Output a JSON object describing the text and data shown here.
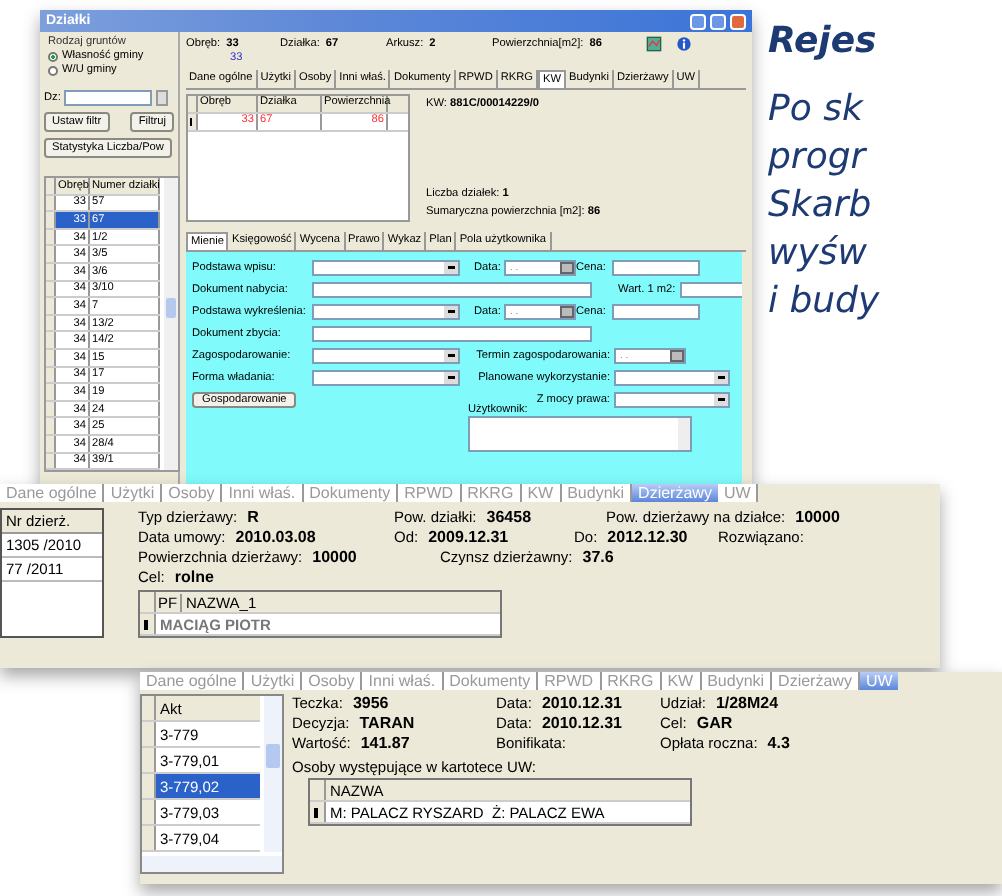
{
  "main_window": {
    "title": "Działki",
    "filter": {
      "title": "Rodzaj gruntów",
      "options": [
        {
          "label": "Własność gminy",
          "selected": true
        },
        {
          "label": "W/U gminy",
          "selected": false
        }
      ],
      "dz_label": "Dz:",
      "buttons": [
        "Ustaw filtr",
        "Filtruj",
        "Statystyka Liczba/Pow"
      ]
    },
    "parcel_table": {
      "columns": [
        "Obręb",
        "Numer działki"
      ],
      "rows": [
        {
          "cells": [
            "33",
            "57"
          ],
          "selected": false
        },
        {
          "cells": [
            "33",
            "67"
          ],
          "selected": true
        },
        {
          "cells": [
            "34",
            "1/2"
          ],
          "selected": false
        },
        {
          "cells": [
            "34",
            "3/5"
          ],
          "selected": false
        },
        {
          "cells": [
            "34",
            "3/6"
          ],
          "selected": false
        },
        {
          "cells": [
            "34",
            "3/10"
          ],
          "selected": false
        },
        {
          "cells": [
            "34",
            "7"
          ],
          "selected": false
        },
        {
          "cells": [
            "34",
            "13/2"
          ],
          "selected": false
        },
        {
          "cells": [
            "34",
            "14/2"
          ],
          "selected": false
        },
        {
          "cells": [
            "34",
            "15"
          ],
          "selected": false
        },
        {
          "cells": [
            "34",
            "17"
          ],
          "selected": false
        },
        {
          "cells": [
            "34",
            "19"
          ],
          "selected": false
        },
        {
          "cells": [
            "34",
            "24"
          ],
          "selected": false
        },
        {
          "cells": [
            "34",
            "25"
          ],
          "selected": false
        },
        {
          "cells": [
            "34",
            "28/4"
          ],
          "selected": false
        },
        {
          "cells": [
            "34",
            "39/1"
          ],
          "selected": false
        }
      ]
    },
    "header": {
      "fields": [
        {
          "label": "Obręb:",
          "value": "33"
        },
        {
          "label": "Działka:",
          "value": "67"
        },
        {
          "label": "Arkusz:",
          "value": "2"
        },
        {
          "label": "Powierzchnia[m2]:",
          "value": "86"
        }
      ],
      "sub_value": "33"
    },
    "tabs": [
      {
        "label": "Dane ogólne",
        "selected": false
      },
      {
        "label": "Użytki",
        "selected": false
      },
      {
        "label": "Osoby",
        "selected": false
      },
      {
        "label": "Inni właś.",
        "selected": false
      },
      {
        "label": "Dokumenty",
        "selected": false
      },
      {
        "label": "RPWD",
        "selected": false
      },
      {
        "label": "RKRG",
        "selected": false
      },
      {
        "label": "KW",
        "selected": true
      },
      {
        "label": "Budynki",
        "selected": false
      },
      {
        "label": "Dzierżawy",
        "selected": false
      },
      {
        "label": "UW",
        "selected": false
      }
    ],
    "kw_table": {
      "columns": [
        "Obręb",
        "Działka",
        "Powierzchnia"
      ],
      "rows": [
        [
          "33",
          "67",
          "86"
        ]
      ]
    },
    "kw": {
      "label": "KW:",
      "value": "881C/00014229/0"
    },
    "summary": [
      {
        "label": "Liczba działek:",
        "value": "1"
      },
      {
        "label": "Sumaryczna powierzchnia [m2]:",
        "value": "86"
      }
    ],
    "lower_tabs": [
      {
        "label": "Mienie",
        "selected": true
      },
      {
        "label": "Księgowość",
        "selected": false
      },
      {
        "label": "Wycena",
        "selected": false
      },
      {
        "label": "Prawo",
        "selected": false
      },
      {
        "label": "Wykaz",
        "selected": false
      },
      {
        "label": "Plan",
        "selected": false
      },
      {
        "label": "Pola użytkownika",
        "selected": false
      }
    ],
    "form": [
      [
        {
          "kind": "select",
          "label": "Podstawa wpisu:"
        },
        {
          "kind": "date",
          "label": "Data:",
          "placeholder": ". ."
        },
        {
          "kind": "text",
          "label": "Cena:"
        }
      ],
      [
        {
          "kind": "text",
          "label": "Dokument nabycia:"
        },
        {
          "kind": "text",
          "label": "Wart. 1 m2:"
        }
      ],
      [
        {
          "kind": "select",
          "label": "Podstawa wykreślenia:"
        },
        {
          "kind": "date",
          "label": "Data:",
          "placeholder": ". ."
        },
        {
          "kind": "text",
          "label": "Cena:"
        }
      ],
      [
        {
          "kind": "text",
          "label": "Dokument zbycia:"
        }
      ],
      [
        {
          "kind": "select",
          "label": "Zagospodarowanie:"
        },
        {
          "kind": "date",
          "label": "Termin zagospodarowania:",
          "placeholder": ". ."
        }
      ],
      [
        {
          "kind": "select",
          "label": "Forma władania:"
        },
        {
          "kind": "select",
          "label": "Planowane wykorzystanie:"
        }
      ],
      [
        {
          "kind": "button",
          "label": "Gospodarowanie"
        },
        {
          "kind": "select",
          "label": "Z mocy prawa:"
        }
      ],
      [
        {
          "kind": "textarea",
          "label": "Użytkownik:"
        }
      ]
    ]
  },
  "lease_window": {
    "tabs": [
      {
        "label": "Dane ogólne",
        "selected": false
      },
      {
        "label": "Użytki",
        "selected": false
      },
      {
        "label": "Osoby",
        "selected": false
      },
      {
        "label": "Inni właś.",
        "selected": false
      },
      {
        "label": "Dokumenty",
        "selected": false
      },
      {
        "label": "RPWD",
        "selected": false
      },
      {
        "label": "RKRG",
        "selected": false
      },
      {
        "label": "KW",
        "selected": false
      },
      {
        "label": "Budynki",
        "selected": false
      },
      {
        "label": "Dzierżawy",
        "selected": true
      },
      {
        "label": "UW",
        "selected": false
      }
    ],
    "lease_table": {
      "columns": [
        "Nr dzierż."
      ],
      "rows": [
        "1305 /2010",
        "77 /2011"
      ]
    },
    "fields": [
      [
        {
          "label": "Typ dzierżawy:",
          "value": "R"
        },
        {
          "label": "Pow. działki:",
          "value": "36458"
        },
        {
          "label": "Pow. dzierżawy na działce:",
          "value": "10000"
        }
      ],
      [
        {
          "label": "Data umowy:",
          "value": "2010.03.08"
        },
        {
          "label": "Od:",
          "value": "2009.12.31"
        },
        {
          "label": "Do:",
          "value": "2012.12.30"
        },
        {
          "label": "Rozwiązano:"
        }
      ],
      [
        {
          "label": "Powierzchnia dzierżawy:",
          "value": "10000"
        },
        {
          "label": "Czynsz dzierżawny:",
          "value": "37.6"
        }
      ],
      [
        {
          "label": "Cel:",
          "value": "rolne"
        }
      ]
    ],
    "tenant_table": {
      "columns": [
        "PF",
        "NAZWA_1"
      ],
      "rows": [
        "MACIĄG PIOTR"
      ]
    }
  },
  "uw_window": {
    "tabs": [
      {
        "label": "Dane ogólne",
        "selected": false
      },
      {
        "label": "Użytki",
        "selected": false
      },
      {
        "label": "Osoby",
        "selected": false
      },
      {
        "label": "Inni właś.",
        "selected": false
      },
      {
        "label": "Dokumenty",
        "selected": false
      },
      {
        "label": "RPWD",
        "selected": false
      },
      {
        "label": "RKRG",
        "selected": false
      },
      {
        "label": "KW",
        "selected": false
      },
      {
        "label": "Budynki",
        "selected": false
      },
      {
        "label": "Dzierżawy",
        "selected": false
      },
      {
        "label": "UW",
        "selected": true
      }
    ],
    "akt_table": {
      "columns": [
        "Akt"
      ],
      "rows": [
        {
          "label": "3-779",
          "selected": false
        },
        {
          "label": "3-779,01",
          "selected": false
        },
        {
          "label": "3-779,02",
          "selected": true
        },
        {
          "label": "3-779,03",
          "selected": false
        },
        {
          "label": "3-779,04",
          "selected": false
        }
      ]
    },
    "fields": [
      [
        {
          "label": "Teczka:",
          "value": "3956"
        },
        {
          "label": "Data:",
          "value": "2010.12.31"
        },
        {
          "label": "Udział:",
          "value": "1/28M24"
        }
      ],
      [
        {
          "label": "Decyzja:",
          "value": "TARAN"
        },
        {
          "label": "Data:",
          "value": "2010.12.31"
        },
        {
          "label": "Cel:",
          "value": "GAR"
        }
      ],
      [
        {
          "label": "Wartość:",
          "value": "141.87"
        },
        {
          "label": "Bonifikata:"
        },
        {
          "label": "Opłata roczna:",
          "value": "4.3"
        }
      ]
    ],
    "persons_caption": "Osoby występujące w kartotece UW:",
    "persons_table": {
      "columns": [
        "NAZWA"
      ],
      "rows": [
        "M: PALACZ RYSZARD  Ż: PALACZ EWA"
      ]
    }
  },
  "side_text": {
    "heading": "Rejes",
    "lines": [
      "Po sk",
      "progr",
      "Skarb",
      "wyśw",
      "i budy"
    ]
  }
}
